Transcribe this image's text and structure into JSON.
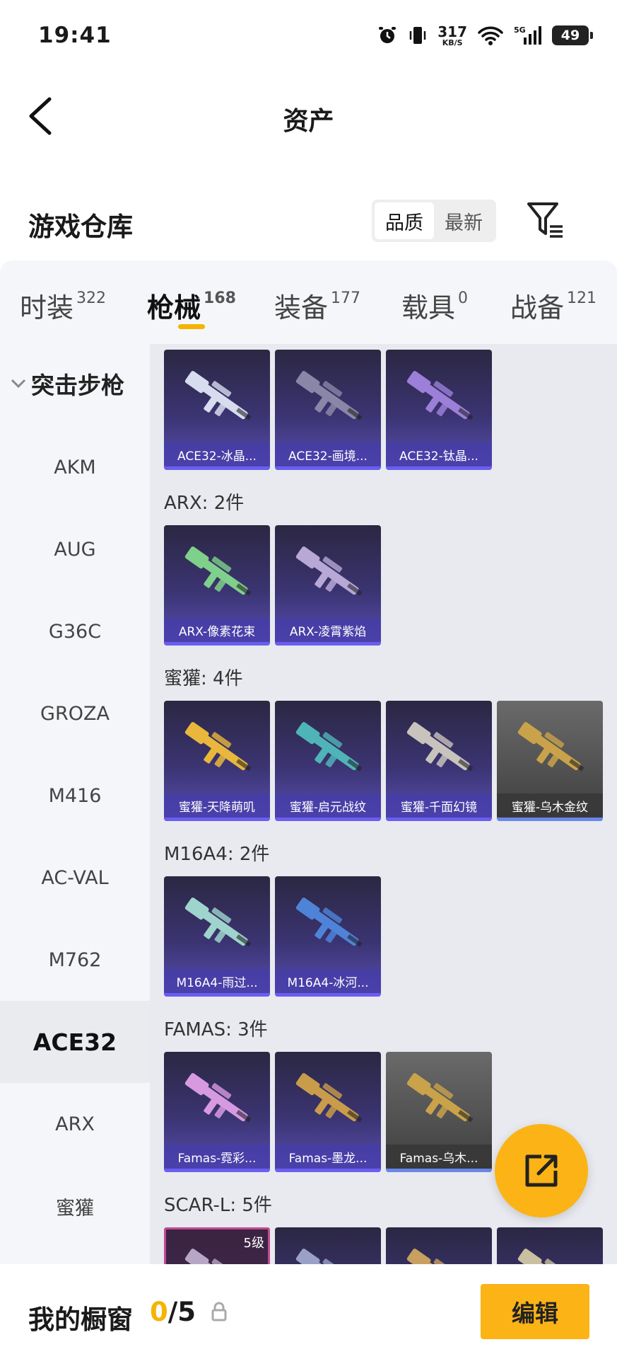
{
  "status_bar": {
    "time": "19:41",
    "net_speed": "317",
    "net_speed_unit": "KB/S",
    "network": "5G",
    "battery": "49"
  },
  "header": {
    "title": "资产"
  },
  "warehouse": {
    "title": "游戏仓库",
    "sort_options": [
      {
        "label": "品质",
        "selected": true
      },
      {
        "label": "最新",
        "selected": false
      }
    ]
  },
  "tabs": [
    {
      "label": "时装",
      "count": "322",
      "active": false
    },
    {
      "label": "枪械",
      "count": "168",
      "active": true
    },
    {
      "label": "装备",
      "count": "177",
      "active": false
    },
    {
      "label": "载具",
      "count": "0",
      "active": false
    },
    {
      "label": "战备",
      "count": "121",
      "active": false
    }
  ],
  "sidebar": {
    "group": "突击步枪",
    "items": [
      {
        "label": "AKM",
        "active": false
      },
      {
        "label": "AUG",
        "active": false
      },
      {
        "label": "G36C",
        "active": false
      },
      {
        "label": "GROZA",
        "active": false
      },
      {
        "label": "M416",
        "active": false
      },
      {
        "label": "AC-VAL",
        "active": false
      },
      {
        "label": "M762",
        "active": false
      },
      {
        "label": "ACE32",
        "active": true
      },
      {
        "label": "ARX",
        "active": false
      },
      {
        "label": "蜜獾",
        "active": false
      }
    ]
  },
  "sections": [
    {
      "title": "",
      "items": [
        {
          "label": "ACE32-冰晶...",
          "style": "purple",
          "gun_color": "#d8dcef"
        },
        {
          "label": "ACE32-画境...",
          "style": "purple",
          "gun_color": "#8a86a8"
        },
        {
          "label": "ACE32-钛晶...",
          "style": "purple",
          "gun_color": "#9b7fd8"
        }
      ]
    },
    {
      "title": "ARX: 2件",
      "items": [
        {
          "label": "ARX-像素花束",
          "style": "purple",
          "gun_color": "#7fd08a"
        },
        {
          "label": "ARX-凌霄紫焰",
          "style": "purple",
          "gun_color": "#b7a8d6"
        }
      ]
    },
    {
      "title": "蜜獾: 4件",
      "items": [
        {
          "label": "蜜獾-天降萌叽",
          "style": "purple",
          "gun_color": "#e8b73c"
        },
        {
          "label": "蜜獾-启元战纹",
          "style": "purple",
          "gun_color": "#4fb4b8"
        },
        {
          "label": "蜜獾-千面幻镜",
          "style": "purple",
          "gun_color": "#c9c3bd"
        },
        {
          "label": "蜜獾-乌木金纹",
          "style": "grey",
          "gun_color": "#caa24a"
        }
      ]
    },
    {
      "title": "M16A4: 2件",
      "items": [
        {
          "label": "M16A4-雨过...",
          "style": "purple",
          "gun_color": "#9fd4cc"
        },
        {
          "label": "M16A4-冰河...",
          "style": "purple",
          "gun_color": "#4f83d8"
        }
      ]
    },
    {
      "title": "FAMAS: 3件",
      "items": [
        {
          "label": "Famas-霓彩...",
          "style": "purple",
          "gun_color": "#d79ae0"
        },
        {
          "label": "Famas-墨龙...",
          "style": "purple",
          "gun_color": "#c89c4a"
        },
        {
          "label": "Famas-乌木...",
          "style": "grey",
          "gun_color": "#c9a24a"
        }
      ]
    },
    {
      "title": "SCAR-L: 5件",
      "items": [
        {
          "label": "",
          "level": "5级",
          "style": "pink",
          "gun_color": "#b7a6c6"
        },
        {
          "label": "",
          "style": "purple",
          "gun_color": "#9aa0c8"
        },
        {
          "label": "",
          "style": "purple",
          "gun_color": "#c8a060"
        },
        {
          "label": "",
          "style": "purple",
          "gun_color": "#c8c0a0"
        }
      ]
    }
  ],
  "showcase": {
    "title": "我的橱窗",
    "used": "0",
    "total": "/5",
    "edit_label": "编辑"
  },
  "colors": {
    "accent": "#fbb316",
    "tab_indicator": "#f5b400"
  }
}
